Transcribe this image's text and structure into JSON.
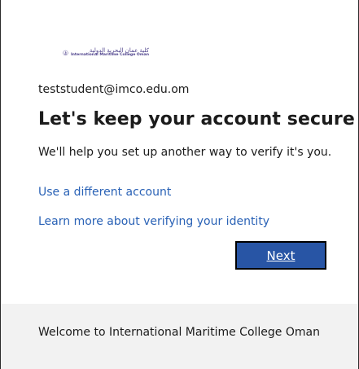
{
  "logo": {
    "arabic_text": "كلية عمان البحرية الدولية",
    "english_text": "International Maritime College Oman",
    "brand_color": "#4b3f8a"
  },
  "account": {
    "email": "teststudent@imco.edu.om"
  },
  "heading": {
    "title": "Let's keep your account secure",
    "description": "We'll help you set up another way to verify it's you."
  },
  "links": {
    "different_account": "Use a different account",
    "learn_more": "Learn more about verifying your identity",
    "link_color": "#2a62b6"
  },
  "actions": {
    "next_label": "Next",
    "next_color": "#2855a5"
  },
  "footer": {
    "text": "Welcome to International Maritime College Oman"
  }
}
